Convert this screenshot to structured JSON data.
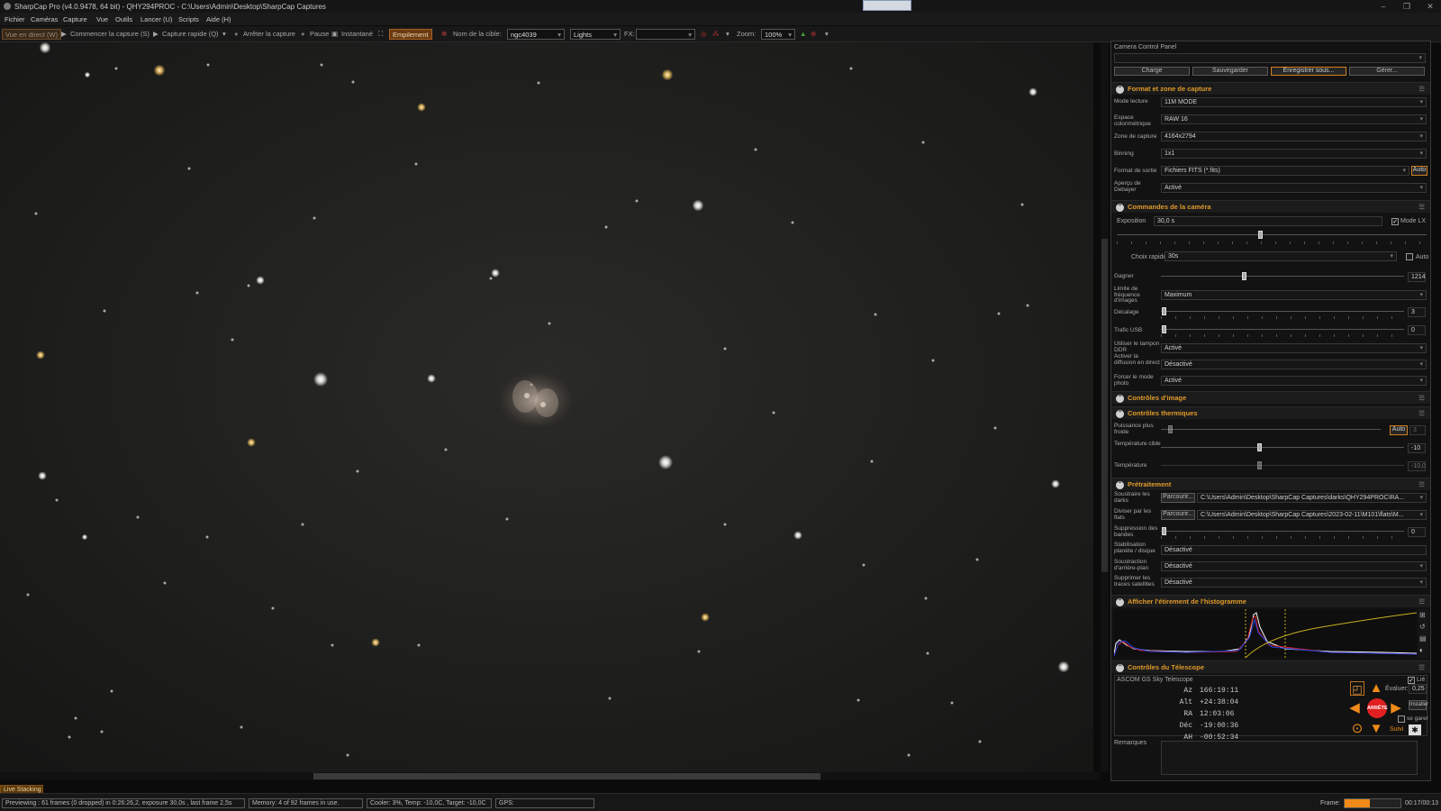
{
  "window": {
    "title": "SharpCap Pro (v4.0.9478, 64 bit) - QHY294PROC - C:\\Users\\Admin\\Desktop\\SharpCap Captures"
  },
  "menu": [
    "Fichier",
    "Caméras",
    "Capture",
    "Vue",
    "Outils",
    "Lancer (U)",
    "Scripts",
    "Aide (H)"
  ],
  "toolbar": {
    "live_view": "Vue en direct (W)",
    "start_capture": "Commencer la capture (S)",
    "quick_capture": "Capture rapide (Q)",
    "stop_capture": "Arrêter la capture",
    "pause": "Pause",
    "snapshot": "Instantané",
    "stacking": "Empilement",
    "target_label": "Nom de la cible:",
    "target_value": "ngc4039",
    "frame_type": "Lights",
    "fx_label": "FX:",
    "fx_value": "",
    "zoom_label": "Zoom:",
    "zoom_value": "100%"
  },
  "panel": {
    "title": "Camera Control Panel",
    "profile_value": "",
    "buttons": [
      "Charge",
      "Sauvegarder",
      "Enregistrer sous...",
      "Gérer..."
    ],
    "sections": {
      "format": "Format et zone de capture",
      "camera": "Commandes de la caméra",
      "image": "Contrôles d'image",
      "thermal": "Contrôles thermiques",
      "preprocessing": "Prétraitement",
      "histogram": "Afficher l'étirement de l'histogramme",
      "telescope": "Contrôles du Télescope"
    },
    "format": [
      {
        "label": "Mode lecture",
        "value": "11M MODE"
      },
      {
        "label": "Espace colorimétrique",
        "value": "RAW 16"
      },
      {
        "label": "Zone de capture",
        "value": "4164x2794"
      },
      {
        "label": "Binning",
        "value": "1x1"
      },
      {
        "label": "Format de sortie",
        "value": "Fichiers FITS (*.fits)",
        "extra": "Auto"
      },
      {
        "label": "Aperçu de Debayer",
        "value": "Activé"
      }
    ],
    "camera": {
      "exposure_label": "Exposition",
      "exposure_value": "30,0 s",
      "lx_label": "Mode LX",
      "quick_label": "Choix rapides",
      "quick_value": "30s",
      "auto_label": "Auto",
      "gain_label": "Gagner",
      "gain_value": "1214",
      "frame_limit_label": "Limite de fréquence d'images",
      "frame_limit_value": "Maximum",
      "offset_label": "Décalage",
      "offset_value": "3",
      "usb_label": "Trafic USB",
      "usb_value": "0",
      "ddr_label": "Utiliser le tampon DDR",
      "ddr_value": "Activé",
      "live_broadcast_label": "Activer la diffusion en direct",
      "live_broadcast_value": "Désactivé",
      "photo_mode_label": "Forcer le mode photo",
      "photo_mode_value": "Activé"
    },
    "thermal": {
      "cooler_label": "Puissance plus froide",
      "cooler_auto": "Auto",
      "cooler_value": "3",
      "target_label": "Température cible",
      "target_value": "-10",
      "temp_label": "Température",
      "temp_value": "-10,0"
    },
    "preprocessing": {
      "darks_label": "Soustraire les darks",
      "browse": "Parcourir...",
      "darks_path": "C:\\Users\\Admin\\Desktop\\SharpCap Captures\\darks\\QHY294PROC\\RA...",
      "flats_label": "Diviser par les flats",
      "flats_path": "C:\\Users\\Admin\\Desktop\\SharpCap Captures\\2023-02-11\\M101\\flats\\M...",
      "banding_label": "Suppression des bandes",
      "banding_value": "0",
      "stabilize_label": "Stabilisation planète / disque",
      "stabilize_value": "Désactivé",
      "background_label": "Soustraction d'arrière-plan",
      "background_value": "Désactivé",
      "satellite_label": "Supprimer les traces satellites",
      "satellite_value": "Désactivé"
    },
    "telescope": {
      "name": "ASCOM GS Sky Telescope",
      "linked": "Lié",
      "rows": [
        {
          "k": "Az",
          "v": "166:19:11"
        },
        {
          "k": "Alt",
          "v": "+24:38:04"
        },
        {
          "k": "RA",
          "v": "12:03:06"
        },
        {
          "k": "Déc",
          "v": "-19:00:36"
        },
        {
          "k": "AH",
          "v": "-00:52:34"
        }
      ],
      "rate_label": "Évaluer:",
      "rate_value": "0,25",
      "install": "Installer",
      "stop": "ARRÊTE",
      "park": "se garer",
      "track": "Suivi"
    },
    "notes_label": "Remarques"
  },
  "status": {
    "live_stacking": "Live Stacking",
    "preview": "Previewing : 61 frames (0 dropped) in 0:26:26,2, exposure 30,0s , last frame 2,5s",
    "memory": "Memory: 4 of 92 frames in use.",
    "cooler": "Cooler: 3%, Temp: -10,0C, Target: -10,0C",
    "gps": "GPS:",
    "frame_label": "Frame:",
    "frame_progress": 0.45,
    "frame_time": "00:17/00:13"
  },
  "colors": {
    "accent": "#e09a2a",
    "stack_button": "#a86020",
    "progress": "#f08a18"
  }
}
